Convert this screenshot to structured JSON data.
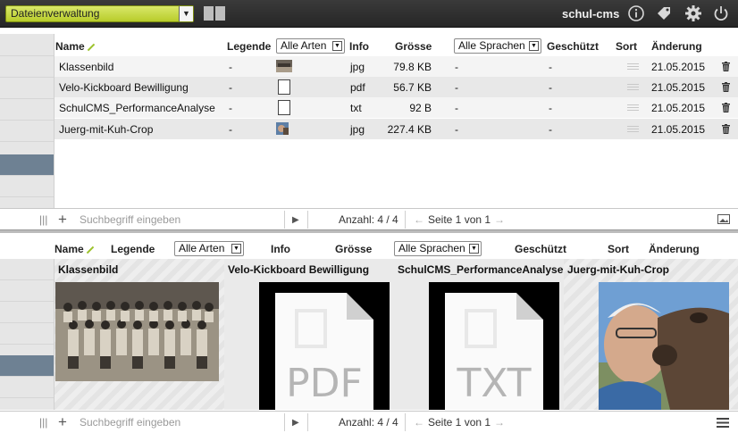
{
  "topbar": {
    "module_select": "Dateienverwaltung",
    "app_name": "schul-cms"
  },
  "columns": {
    "name": "Name",
    "legende": "Legende",
    "arten_select": "Alle Arten",
    "info": "Info",
    "groesse": "Grösse",
    "sprachen_select": "Alle Sprachen",
    "geschuetzt": "Geschützt",
    "sort": "Sort",
    "aenderung": "Änderung"
  },
  "rows": [
    {
      "name": "Klassenbild",
      "legende": "-",
      "type": "jpg",
      "size": "79.8 KB",
      "lang": "-",
      "protected": "-",
      "date": "21.05.2015"
    },
    {
      "name": "Velo-Kickboard Bewilligung",
      "legende": "-",
      "type": "pdf",
      "size": "56.7 KB",
      "lang": "-",
      "protected": "-",
      "date": "21.05.2015"
    },
    {
      "name": "SchulCMS_PerformanceAnalyse",
      "legende": "-",
      "type": "txt",
      "size": "92 B",
      "lang": "-",
      "protected": "-",
      "date": "21.05.2015"
    },
    {
      "name": "Juerg-mit-Kuh-Crop",
      "legende": "-",
      "type": "jpg",
      "size": "227.4 KB",
      "lang": "-",
      "protected": "-",
      "date": "21.05.2015"
    }
  ],
  "footer": {
    "search_placeholder": "Suchbegriff eingeben",
    "count": "Anzahl: 4 / 4",
    "page": "Seite 1 von 1",
    "prev_arrow": "←",
    "next_arrow": "→"
  },
  "tiles": [
    {
      "title": "Klassenbild"
    },
    {
      "title": "Velo-Kickboard Bewilligung",
      "doc_label": "PDF"
    },
    {
      "title": "SchulCMS_PerformanceAnalyse",
      "doc_label": "TXT"
    },
    {
      "title": "Juerg-mit-Kuh-Crop"
    }
  ],
  "icons": {
    "info": "info-icon",
    "tag": "tag-icon",
    "settings": "gear-icon",
    "power": "power-icon",
    "add": "plus-icon",
    "play": "play-icon",
    "trash": "trash-icon",
    "image": "image-icon",
    "menu": "hamburger-icon"
  },
  "colors": {
    "accent": "#c3d43a",
    "selection": "#6e8193",
    "topbar": "#2e2e2e"
  }
}
